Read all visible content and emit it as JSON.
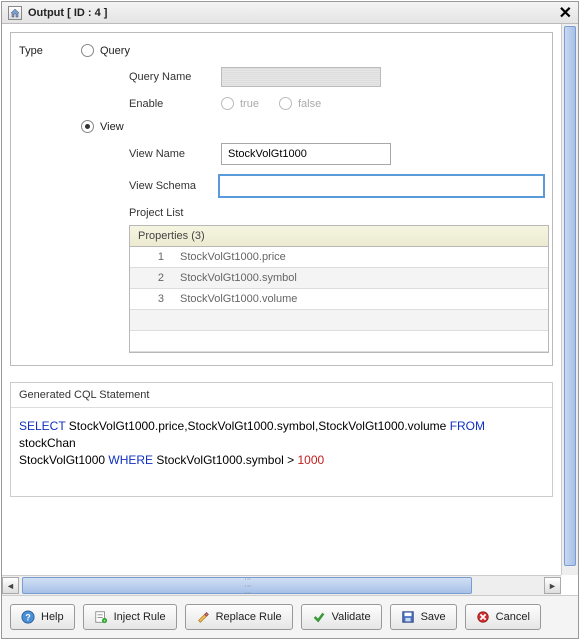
{
  "titlebar": {
    "title": "Output [ ID : 4 ]"
  },
  "form": {
    "type_label": "Type",
    "query": {
      "radio_label": "Query",
      "name_label": "Query Name",
      "enable_label": "Enable",
      "true_label": "true",
      "false_label": "false"
    },
    "view": {
      "radio_label": "View",
      "name_label": "View Name",
      "name_value": "StockVolGt1000",
      "schema_label": "View Schema",
      "schema_value": "",
      "project_list_label": "Project List",
      "grid_header": "Properties (3)",
      "rows": [
        {
          "n": "1",
          "v": "StockVolGt1000.price"
        },
        {
          "n": "2",
          "v": "StockVolGt1000.symbol"
        },
        {
          "n": "3",
          "v": "StockVolGt1000.volume"
        }
      ]
    }
  },
  "cql": {
    "title": "Generated CQL Statement",
    "kw_select": "SELECT",
    "fields": " StockVolGt1000.price,StockVolGt1000.symbol,StockVolGt1000.volume ",
    "kw_from": "FROM",
    "from_txt": " stockChan",
    "line2_pre": "StockVolGt1000 ",
    "kw_where": "WHERE",
    "where_txt": " StockVolGt1000.symbol > ",
    "num_1000": "1000"
  },
  "buttons": {
    "help": "Help",
    "inject": "Inject Rule",
    "replace": "Replace Rule",
    "validate": "Validate",
    "save": "Save",
    "cancel": "Cancel"
  }
}
